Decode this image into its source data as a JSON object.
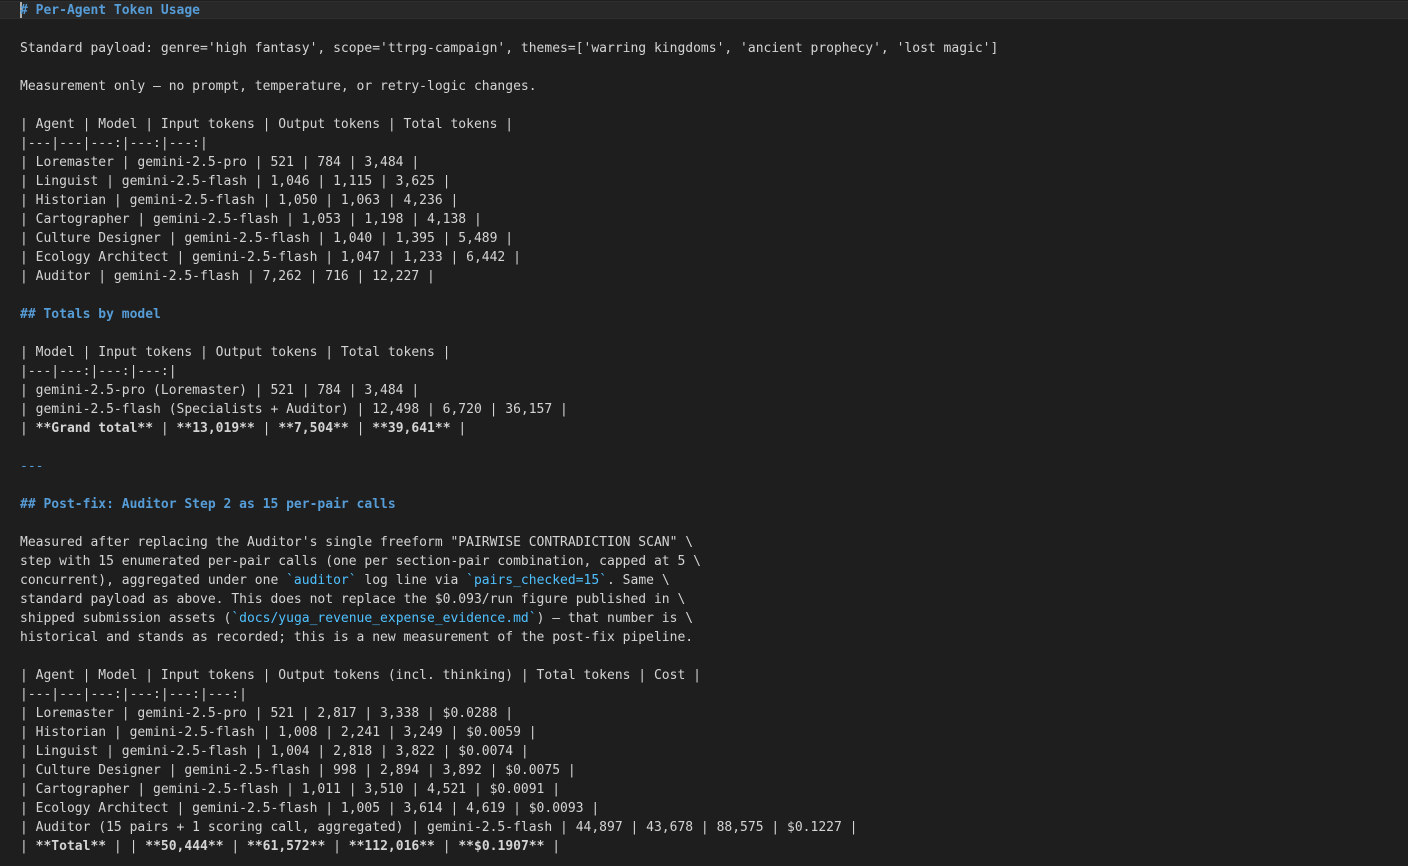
{
  "lines": [
    [
      {
        "t": "# Per-Agent Token Usage",
        "c": "heading"
      }
    ],
    [],
    [
      {
        "t": "Standard payload: genre='high fantasy', scope='ttrpg-campaign', themes=['warring kingdoms', 'ancient prophecy', 'lost magic']"
      }
    ],
    [],
    [
      {
        "t": "Measurement only — no prompt, temperature, or retry-logic changes."
      }
    ],
    [],
    [
      {
        "t": "| Agent | Model | Input tokens | Output tokens | Total tokens |"
      }
    ],
    [
      {
        "t": "|---|---|---:|---:|---:|"
      }
    ],
    [
      {
        "t": "| Loremaster | gemini-2.5-pro | 521 | 784 | 3,484 |"
      }
    ],
    [
      {
        "t": "| Linguist | gemini-2.5-flash | 1,046 | 1,115 | 3,625 |"
      }
    ],
    [
      {
        "t": "| Historian | gemini-2.5-flash | 1,050 | 1,063 | 4,236 |"
      }
    ],
    [
      {
        "t": "| Cartographer | gemini-2.5-flash | 1,053 | 1,198 | 4,138 |"
      }
    ],
    [
      {
        "t": "| Culture Designer | gemini-2.5-flash | 1,040 | 1,395 | 5,489 |"
      }
    ],
    [
      {
        "t": "| Ecology Architect | gemini-2.5-flash | 1,047 | 1,233 | 6,442 |"
      }
    ],
    [
      {
        "t": "| Auditor | gemini-2.5-flash | 7,262 | 716 | 12,227 |"
      }
    ],
    [],
    [
      {
        "t": "## Totals by model",
        "c": "heading"
      }
    ],
    [],
    [
      {
        "t": "| Model | Input tokens | Output tokens | Total tokens |"
      }
    ],
    [
      {
        "t": "|---|---:|---:|---:|"
      }
    ],
    [
      {
        "t": "| gemini-2.5-pro (Loremaster) | 521 | 784 | 3,484 |"
      }
    ],
    [
      {
        "t": "| gemini-2.5-flash (Specialists + Auditor) | 12,498 | 6,720 | 36,157 |"
      }
    ],
    [
      {
        "t": "| "
      },
      {
        "t": "**Grand total**",
        "c": "bold"
      },
      {
        "t": " | "
      },
      {
        "t": "**13,019**",
        "c": "bold"
      },
      {
        "t": " | "
      },
      {
        "t": "**7,504**",
        "c": "bold"
      },
      {
        "t": " | "
      },
      {
        "t": "**39,641**",
        "c": "bold"
      },
      {
        "t": " |"
      }
    ],
    [],
    [
      {
        "t": "---",
        "c": "hr"
      }
    ],
    [],
    [
      {
        "t": "## Post-fix: Auditor Step 2 as 15 per-pair calls",
        "c": "heading"
      }
    ],
    [],
    [
      {
        "t": "Measured after replacing the Auditor's single freeform \"PAIRWISE CONTRADICTION SCAN\" \\"
      }
    ],
    [
      {
        "t": "step with 15 enumerated per-pair calls (one per section-pair combination, capped at 5 \\"
      }
    ],
    [
      {
        "t": "concurrent), aggregated under one "
      },
      {
        "t": "`auditor`",
        "c": "code"
      },
      {
        "t": " log line via "
      },
      {
        "t": "`pairs_checked=15`",
        "c": "code"
      },
      {
        "t": ". Same \\"
      }
    ],
    [
      {
        "t": "standard payload as above. This does not replace the $0.093/run figure published in \\"
      }
    ],
    [
      {
        "t": "shipped submission assets ("
      },
      {
        "t": "`docs/yuga_revenue_expense_evidence.md`",
        "c": "code"
      },
      {
        "t": ") — that number is \\"
      }
    ],
    [
      {
        "t": "historical and stands as recorded; this is a new measurement of the post-fix pipeline."
      }
    ],
    [],
    [
      {
        "t": "| Agent | Model | Input tokens | Output tokens (incl. thinking) | Total tokens | Cost |"
      }
    ],
    [
      {
        "t": "|---|---|---:|---:|---:|---:|"
      }
    ],
    [
      {
        "t": "| Loremaster | gemini-2.5-pro | 521 | 2,817 | 3,338 | $0.0288 |"
      }
    ],
    [
      {
        "t": "| Historian | gemini-2.5-flash | 1,008 | 2,241 | 3,249 | $0.0059 |"
      }
    ],
    [
      {
        "t": "| Linguist | gemini-2.5-flash | 1,004 | 2,818 | 3,822 | $0.0074 |"
      }
    ],
    [
      {
        "t": "| Culture Designer | gemini-2.5-flash | 998 | 2,894 | 3,892 | $0.0075 |"
      }
    ],
    [
      {
        "t": "| Cartographer | gemini-2.5-flash | 1,011 | 3,510 | 4,521 | $0.0091 |"
      }
    ],
    [
      {
        "t": "| Ecology Architect | gemini-2.5-flash | 1,005 | 3,614 | 4,619 | $0.0093 |"
      }
    ],
    [
      {
        "t": "| Auditor (15 pairs + 1 scoring call, aggregated) | gemini-2.5-flash | 44,897 | 43,678 | 88,575 | $0.1227 |"
      }
    ],
    [
      {
        "t": "| "
      },
      {
        "t": "**Total**",
        "c": "bold"
      },
      {
        "t": " | | "
      },
      {
        "t": "**50,444**",
        "c": "bold"
      },
      {
        "t": " | "
      },
      {
        "t": "**61,572**",
        "c": "bold"
      },
      {
        "t": " | "
      },
      {
        "t": "**112,016**",
        "c": "bold"
      },
      {
        "t": " | "
      },
      {
        "t": "**$0.1907**",
        "c": "bold"
      },
      {
        "t": " |"
      }
    ]
  ],
  "colors": {
    "background": "#1e1e1e",
    "text": "#d4d4d4",
    "heading": "#569cd6",
    "code": "#4fc1ff",
    "current_line": "#282828"
  }
}
